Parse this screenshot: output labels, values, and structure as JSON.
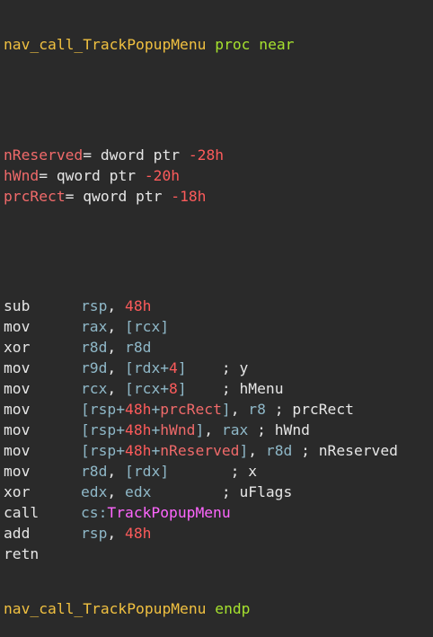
{
  "proc": {
    "name": "nav_call_TrackPopupMenu",
    "keyword": "proc near",
    "end_keyword": "endp"
  },
  "vars": [
    {
      "name": "nReserved",
      "eq": "= dword ptr ",
      "offset": "-28h"
    },
    {
      "name": "hWnd",
      "eq": "= qword ptr ",
      "offset": "-20h"
    },
    {
      "name": "prcRect",
      "eq": "= qword ptr ",
      "offset": "-18h"
    }
  ],
  "instructions": [
    {
      "mnem": "sub",
      "ops": [
        {
          "t": "reg",
          "v": "rsp"
        },
        {
          "t": "plain",
          "v": ", "
        },
        {
          "t": "num",
          "v": "48h"
        }
      ]
    },
    {
      "mnem": "mov",
      "ops": [
        {
          "t": "reg",
          "v": "rax"
        },
        {
          "t": "plain",
          "v": ", "
        },
        {
          "t": "reg",
          "v": "[rcx]"
        }
      ]
    },
    {
      "mnem": "xor",
      "ops": [
        {
          "t": "reg",
          "v": "r8d"
        },
        {
          "t": "plain",
          "v": ", "
        },
        {
          "t": "reg",
          "v": "r8d"
        }
      ]
    },
    {
      "mnem": "mov",
      "ops": [
        {
          "t": "reg",
          "v": "r9d"
        },
        {
          "t": "plain",
          "v": ", "
        },
        {
          "t": "reg",
          "v": "[rdx+"
        },
        {
          "t": "num",
          "v": "4"
        },
        {
          "t": "reg",
          "v": "]"
        },
        {
          "t": "plain",
          "v": "    ; y"
        }
      ]
    },
    {
      "mnem": "mov",
      "ops": [
        {
          "t": "reg",
          "v": "rcx"
        },
        {
          "t": "plain",
          "v": ", "
        },
        {
          "t": "reg",
          "v": "[rcx+"
        },
        {
          "t": "num",
          "v": "8"
        },
        {
          "t": "reg",
          "v": "]"
        },
        {
          "t": "plain",
          "v": "    ; hMenu"
        }
      ]
    },
    {
      "mnem": "mov",
      "ops": [
        {
          "t": "reg",
          "v": "[rsp+"
        },
        {
          "t": "num",
          "v": "48h"
        },
        {
          "t": "reg",
          "v": "+"
        },
        {
          "t": "var",
          "v": "prcRect"
        },
        {
          "t": "reg",
          "v": "]"
        },
        {
          "t": "plain",
          "v": ", "
        },
        {
          "t": "reg",
          "v": "r8"
        },
        {
          "t": "plain",
          "v": " ; prcRect"
        }
      ]
    },
    {
      "mnem": "mov",
      "ops": [
        {
          "t": "reg",
          "v": "[rsp+"
        },
        {
          "t": "num",
          "v": "48h"
        },
        {
          "t": "reg",
          "v": "+"
        },
        {
          "t": "var",
          "v": "hWnd"
        },
        {
          "t": "reg",
          "v": "]"
        },
        {
          "t": "plain",
          "v": ", "
        },
        {
          "t": "reg",
          "v": "rax"
        },
        {
          "t": "plain",
          "v": " ; hWnd"
        }
      ]
    },
    {
      "mnem": "mov",
      "ops": [
        {
          "t": "reg",
          "v": "[rsp+"
        },
        {
          "t": "num",
          "v": "48h"
        },
        {
          "t": "reg",
          "v": "+"
        },
        {
          "t": "var",
          "v": "nReserved"
        },
        {
          "t": "reg",
          "v": "]"
        },
        {
          "t": "plain",
          "v": ", "
        },
        {
          "t": "reg",
          "v": "r8d"
        },
        {
          "t": "plain",
          "v": " ; nReserved"
        }
      ]
    },
    {
      "mnem": "mov",
      "ops": [
        {
          "t": "reg",
          "v": "r8d"
        },
        {
          "t": "plain",
          "v": ", "
        },
        {
          "t": "reg",
          "v": "[rdx]"
        },
        {
          "t": "plain",
          "v": "       ; x"
        }
      ]
    },
    {
      "mnem": "xor",
      "ops": [
        {
          "t": "reg",
          "v": "edx"
        },
        {
          "t": "plain",
          "v": ", "
        },
        {
          "t": "reg",
          "v": "edx"
        },
        {
          "t": "plain",
          "v": "        ; uFlags"
        }
      ]
    },
    {
      "mnem": "call",
      "ops": [
        {
          "t": "reg",
          "v": "cs:"
        },
        {
          "t": "func",
          "v": "TrackPopupMenu"
        }
      ]
    },
    {
      "mnem": "add",
      "ops": [
        {
          "t": "reg",
          "v": "rsp"
        },
        {
          "t": "plain",
          "v": ", "
        },
        {
          "t": "num",
          "v": "48h"
        }
      ]
    },
    {
      "mnem": "retn",
      "ops": []
    }
  ]
}
